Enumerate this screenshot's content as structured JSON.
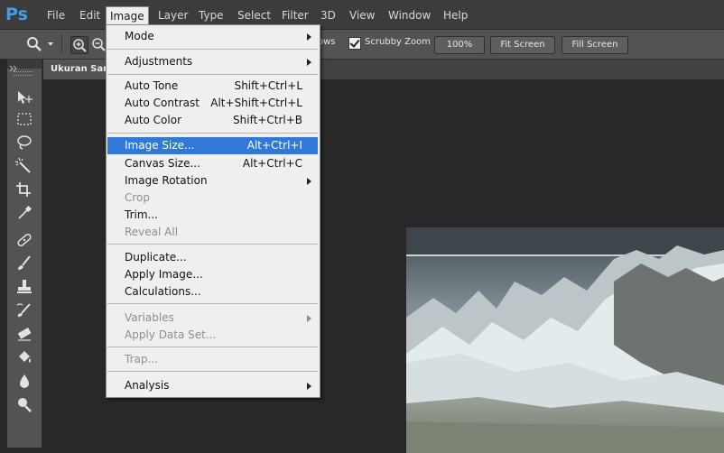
{
  "app": {
    "logo": "Ps",
    "accent": "#3fa0e6"
  },
  "menubar": {
    "items": [
      {
        "label": "File"
      },
      {
        "label": "Edit"
      },
      {
        "label": "Image"
      },
      {
        "label": "Layer"
      },
      {
        "label": "Type"
      },
      {
        "label": "Select"
      },
      {
        "label": "Filter"
      },
      {
        "label": "3D"
      },
      {
        "label": "View"
      },
      {
        "label": "Window"
      },
      {
        "label": "Help"
      }
    ],
    "active": "Image"
  },
  "options_bar": {
    "tool_icon": "zoom-icon",
    "resize_windows_label": "ows",
    "scrubby_zoom_label": "Scrubby Zoom",
    "scrubby_zoom_checked": true,
    "buttons": {
      "zoom_100": "100%",
      "fit_screen": "Fit Screen",
      "fill_screen": "Fill Screen"
    }
  },
  "document_tab": {
    "title": "Ukuran Sam"
  },
  "image_menu": {
    "items": {
      "mode": {
        "label": "Mode",
        "submenu": true
      },
      "adjustments": {
        "label": "Adjustments",
        "submenu": true
      },
      "auto_tone": {
        "label": "Auto Tone",
        "shortcut": "Shift+Ctrl+L"
      },
      "auto_contrast": {
        "label": "Auto Contrast",
        "shortcut": "Alt+Shift+Ctrl+L"
      },
      "auto_color": {
        "label": "Auto Color",
        "shortcut": "Shift+Ctrl+B"
      },
      "image_size": {
        "label": "Image Size...",
        "shortcut": "Alt+Ctrl+I",
        "highlighted": true
      },
      "canvas_size": {
        "label": "Canvas Size...",
        "shortcut": "Alt+Ctrl+C"
      },
      "image_rotation": {
        "label": "Image Rotation",
        "submenu": true
      },
      "crop": {
        "label": "Crop",
        "disabled": true
      },
      "trim": {
        "label": "Trim..."
      },
      "reveal_all": {
        "label": "Reveal All",
        "disabled": true
      },
      "duplicate": {
        "label": "Duplicate..."
      },
      "apply_image": {
        "label": "Apply Image..."
      },
      "calculations": {
        "label": "Calculations..."
      },
      "variables": {
        "label": "Variables",
        "submenu": true,
        "disabled": true
      },
      "apply_data_set": {
        "label": "Apply Data Set...",
        "disabled": true
      },
      "trap": {
        "label": "Trap...",
        "disabled": true
      },
      "analysis": {
        "label": "Analysis",
        "submenu": true
      }
    }
  },
  "tools": [
    "move-tool-icon",
    "marquee-tool-icon",
    "lasso-tool-icon",
    "magic-wand-tool-icon",
    "crop-tool-icon",
    "eyedropper-tool-icon",
    "healing-brush-tool-icon",
    "brush-tool-icon",
    "clone-stamp-tool-icon",
    "history-brush-tool-icon",
    "eraser-tool-icon",
    "paint-bucket-tool-icon",
    "blur-tool-icon",
    "dodge-tool-icon"
  ],
  "colors": {
    "menubar": "#3c3c3c",
    "options_bar": "#535353",
    "workspace": "#282828",
    "menu_highlight": "#3079d6"
  }
}
